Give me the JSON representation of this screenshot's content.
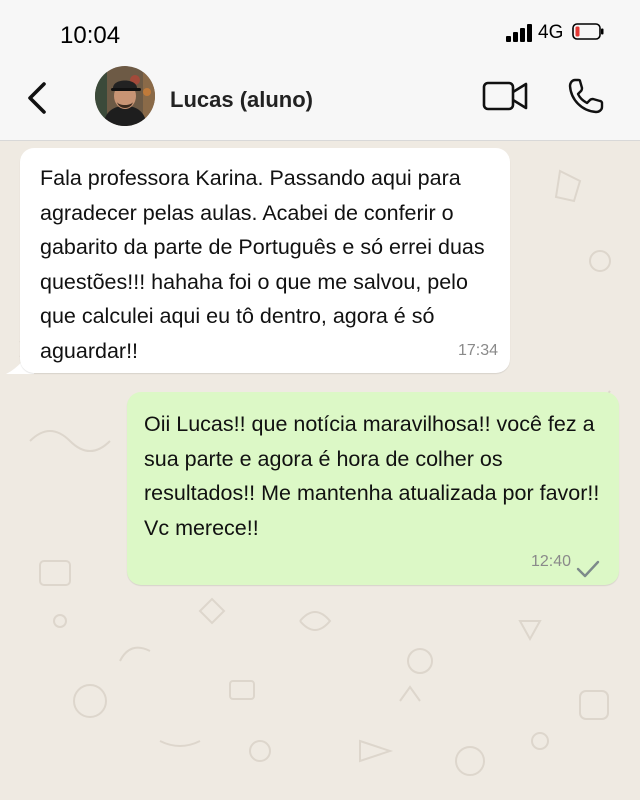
{
  "status": {
    "time": "10:04",
    "network": "4G"
  },
  "header": {
    "contact_name": "Lucas (aluno)"
  },
  "icons": {
    "back": "chevron-left-icon",
    "video": "video-camera-icon",
    "call": "phone-icon",
    "signal": "signal-bars-icon",
    "battery": "battery-low-icon",
    "read": "check-icon"
  },
  "colors": {
    "incoming_bubble": "#ffffff",
    "outgoing_bubble": "#dcf8c6",
    "chat_background": "#efeae2",
    "battery_low": "#e53935"
  },
  "messages": [
    {
      "direction": "incoming",
      "text": "Fala professora Karina. Passando aqui para agradecer pelas aulas. Acabei de conferir o gabarito da parte de Português e só errei duas questões!!! hahaha foi o que me salvou, pelo que calculei aqui eu tô dentro, agora é só aguardar!!",
      "time": "17:34"
    },
    {
      "direction": "outgoing",
      "text": "Oii Lucas!! que notícia maravilhosa!! você fez a sua parte e agora é hora de colher os resultados!! Me mantenha atualizada por favor!! Vc merece!!",
      "time": "12:40"
    }
  ]
}
